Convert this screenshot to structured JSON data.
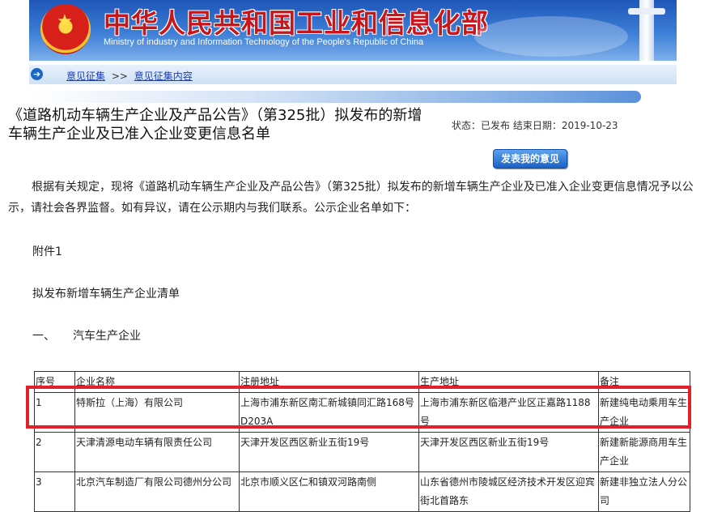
{
  "header": {
    "title_cn": "中华人民共和国工业和信息化部",
    "title_en": "Ministry of industry and Information Technology of the People's Republic of China"
  },
  "breadcrumb": {
    "item1": "意见征集",
    "separator": ">>",
    "item2": "意见征集内容"
  },
  "notice": {
    "title": "《道路机动车辆生产企业及产品公告》（第325批）拟发布的新增车辆生产企业及已准入企业变更信息名单",
    "status": "状态：已发布 结束日期：2019-10-23",
    "submit_button": "发表我的意见",
    "intro": "根据有关规定，现将《道路机动车辆生产企业及产品公告》（第325批）拟发布的新增车辆生产企业及已准入企业变更信息情况予以公示，请社会各界监督。如有异议，请在公示期内与我们联系。公示企业名单如下：",
    "attachment": "附件1",
    "list_title": "拟发布新增车辆生产企业清单",
    "section_num": "一、",
    "section_title": "汽车生产企业"
  },
  "table": {
    "headers": [
      "序号",
      "企业名称",
      "注册地址",
      "生产地址",
      "备注"
    ],
    "rows": [
      [
        "1",
        "特斯拉（上海）有限公司",
        "上海市浦东新区南汇新城镇同汇路168号D203A",
        "上海市浦东新区临港产业区正嘉路1188号",
        "新建纯电动乘用车生产企业"
      ],
      [
        "2",
        "天津清源电动车辆有限责任公司",
        "天津开发区西区新业五街19号",
        "天津开发区西区新业五街19号",
        "新建新能源商用车生产企业"
      ],
      [
        "3",
        "北京汽车制造厂有限公司德州分公司",
        "北京市顺义区仁和镇双河路南侧",
        "山东省德州市陵城区经济技术开发区迎宾街北首路东",
        "新建非独立法人分公司"
      ]
    ]
  },
  "colors": {
    "highlight": "#e0202a",
    "link": "#1a3fb8",
    "header_blue": "#1f56b8"
  }
}
